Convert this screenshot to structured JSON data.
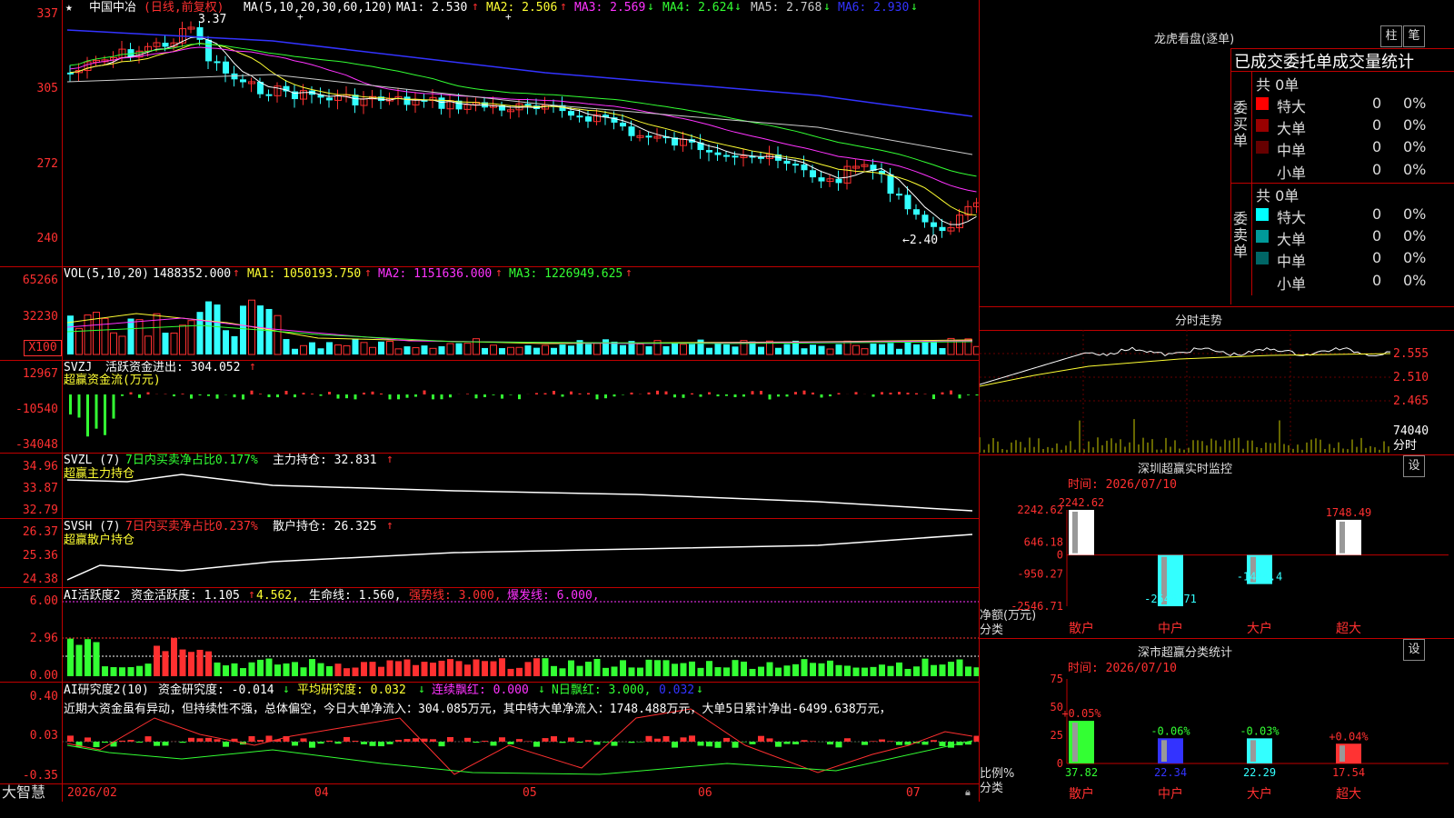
{
  "app": {
    "brand": "大智慧"
  },
  "price_panel": {
    "star": "★",
    "name": "中国中冶",
    "mode": "(日线,前复权)",
    "ma_label": "MA(5,10,20,30,60,120)",
    "ma1": "MA1: 2.530",
    "ma2": "MA2: 2.506",
    "ma3": "MA3: 2.569",
    "ma4": "MA4: 2.624",
    "ma5": "MA5: 2.768",
    "ma6": "MA6: 2.930",
    "high_marker": "3.37",
    "low_marker": "←2.40",
    "yticks": [
      "337",
      "305",
      "272",
      "240"
    ]
  },
  "vol_panel": {
    "label": "VOL(5,10,20)",
    "value": "1488352.000",
    "ma1": "MA1: 1050193.750",
    "ma2": "MA2: 1151636.000",
    "ma3": "MA3: 1226949.625",
    "yticks": [
      "65266",
      "32230",
      "X100"
    ]
  },
  "svzj_panel": {
    "label": "SVZJ",
    "active": "活跃资金进出: 304.052",
    "sub": "超赢资金流(万元)",
    "yticks": [
      "12967",
      "-10540",
      "-34048"
    ]
  },
  "svzl_panel": {
    "label": "SVZL (7)",
    "ratio": "7日内买卖净占比0.177%",
    "hold": "主力持仓: 32.831",
    "sub": "超赢主力持仓",
    "yticks": [
      "34.96",
      "33.87",
      "32.79"
    ]
  },
  "svsh_panel": {
    "label": "SVSH (7)",
    "ratio": "7日内买卖净占比0.237%",
    "hold": "散户持仓: 26.325",
    "sub": "超赢散户持仓",
    "yticks": [
      "26.37",
      "25.36",
      "24.38"
    ]
  },
  "ai_active_panel": {
    "label": "AI活跃度2",
    "v1": "资金活跃度: 1.105",
    "v2": "4.562,",
    "v3": "生命线: 1.560,",
    "v4": "强势线: 3.000,",
    "v5": "爆发线: 6.000,",
    "yticks": [
      "6.00",
      "2.96",
      "0.00"
    ]
  },
  "ai_research_panel": {
    "label": "AI研究度2(10)",
    "v1": "资金研究度: -0.014",
    "v2": "平均研究度: 0.032",
    "v3": "连续飘红: 0.000",
    "v4": "N日飘红: 3.000,",
    "v5": "0.032",
    "comment": "近期大资金虽有异动，但持续性不强，总体偏空，今日大单净流入：304.085万元，其中特大单净流入：1748.488万元，大单5日累计净出-6499.638万元，",
    "yticks": [
      "0.40",
      "0.03",
      "-0.35"
    ]
  },
  "date_axis": [
    "2026/02",
    "04",
    "05",
    "06",
    "07"
  ],
  "dragon_tiger": {
    "title": "龙虎看盘(逐单)",
    "btn_bar": "柱",
    "btn_pen": "笔",
    "heading": "已成交委托单成交量统计",
    "buy": {
      "side_label": "委买单",
      "total": "共 0单",
      "rows": [
        {
          "name": "特大",
          "count": "0",
          "pct": "0%",
          "color": "#ff0000"
        },
        {
          "name": "大单",
          "count": "0",
          "pct": "0%",
          "color": "#990000"
        },
        {
          "name": "中单",
          "count": "0",
          "pct": "0%",
          "color": "#660000"
        },
        {
          "name": "小单",
          "count": "0",
          "pct": "0%",
          "color": "#000000"
        }
      ]
    },
    "sell": {
      "side_label": "委卖单",
      "total": "共 0单",
      "rows": [
        {
          "name": "特大",
          "count": "0",
          "pct": "0%",
          "color": "#00ffff"
        },
        {
          "name": "大单",
          "count": "0",
          "pct": "0%",
          "color": "#009999"
        },
        {
          "name": "中单",
          "count": "0",
          "pct": "0%",
          "color": "#006666"
        },
        {
          "name": "小单",
          "count": "0",
          "pct": "0%",
          "color": "#000000"
        }
      ]
    }
  },
  "intraday": {
    "title": "分时走势",
    "yticks": [
      "2.555",
      "2.510",
      "2.465"
    ],
    "vol_label": "74040",
    "vol_unit": "分时"
  },
  "sz_monitor": {
    "title": "深圳超赢实时监控",
    "btn": "设",
    "time": "时间: 2026/07/10",
    "yticks": [
      "2242.62",
      "646.18",
      "0",
      "-950.27",
      "-2546.71"
    ],
    "ylabel1": "净额(万元)",
    "ylabel2": "分类",
    "cats": [
      "散户",
      "中户",
      "大户",
      "超大"
    ]
  },
  "sz_class": {
    "title": "深市超赢分类统计",
    "btn": "设",
    "time": "时间: 2026/07/10",
    "yticks": [
      "75",
      "50",
      "25",
      "0"
    ],
    "ylabel1": "比例%",
    "ylabel2": "分类",
    "cats": [
      "散户",
      "中户",
      "大户",
      "超大"
    ]
  },
  "chart_data": [
    {
      "type": "bar",
      "title": "深圳超赢实时监控",
      "ylabel": "净额(万元)",
      "xlabel": "分类",
      "categories": [
        "散户",
        "中户",
        "大户",
        "超大"
      ],
      "values": [
        2242.62,
        -2546.71,
        -1444.4,
        1748.49
      ],
      "labels": [
        "2242.62",
        "-2546.71",
        "-1444.4",
        "1748.49"
      ],
      "ylim": [
        -2546.71,
        2242.62
      ],
      "colors": [
        "#ffffff",
        "#33ffff",
        "#33ffff",
        "#ffffff"
      ]
    },
    {
      "type": "bar",
      "title": "深市超赢分类统计",
      "ylabel": "比例%",
      "xlabel": "分类",
      "categories": [
        "散户",
        "中户",
        "大户",
        "超大"
      ],
      "values": [
        37.82,
        22.34,
        22.29,
        17.54
      ],
      "changes": [
        "+0.05%",
        "-0.06%",
        "-0.03%",
        "+0.04%"
      ],
      "ylim": [
        0,
        75
      ],
      "colors": [
        "#33ff33",
        "#3333ff",
        "#33ffff",
        "#ff3333"
      ]
    }
  ]
}
